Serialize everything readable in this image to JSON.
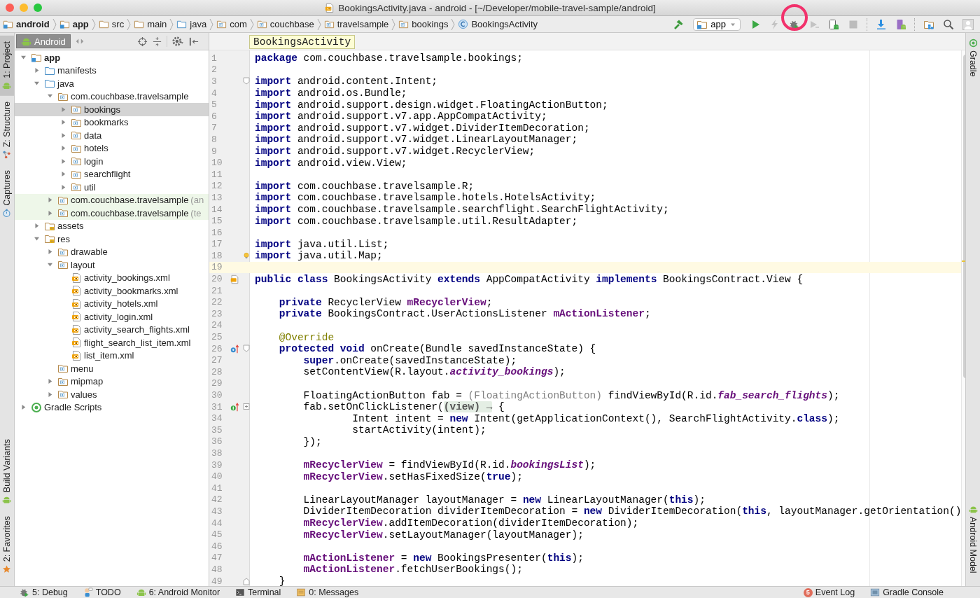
{
  "window": {
    "title": "BookingsActivity.java - android - [~/Developer/mobile-travel-sample/android]"
  },
  "breadcrumbs": [
    {
      "label": "android",
      "kind": "module",
      "bold": true
    },
    {
      "label": "app",
      "kind": "module",
      "bold": true
    },
    {
      "label": "src",
      "kind": "folder",
      "bold": false
    },
    {
      "label": "main",
      "kind": "folder",
      "bold": false
    },
    {
      "label": "java",
      "kind": "source",
      "bold": false
    },
    {
      "label": "com",
      "kind": "package",
      "bold": false
    },
    {
      "label": "couchbase",
      "kind": "package",
      "bold": false
    },
    {
      "label": "travelsample",
      "kind": "package",
      "bold": false
    },
    {
      "label": "bookings",
      "kind": "package",
      "bold": false
    },
    {
      "label": "BookingsActivity",
      "kind": "class",
      "bold": false
    }
  ],
  "toolbar": [
    {
      "kind": "hammer",
      "disabled": false,
      "highlighted": false
    },
    {
      "kind": "config",
      "label": "app",
      "disabled": false,
      "highlighted": false
    },
    {
      "kind": "run",
      "disabled": false,
      "highlighted": false
    },
    {
      "kind": "apply",
      "disabled": true,
      "highlighted": false
    },
    {
      "kind": "debug",
      "disabled": false,
      "highlighted": true
    },
    {
      "kind": "attach",
      "disabled": true,
      "highlighted": false
    },
    {
      "kind": "device",
      "disabled": false,
      "highlighted": false
    },
    {
      "kind": "stop",
      "disabled": true,
      "highlighted": false
    },
    {
      "kind": "sdk",
      "disabled": false,
      "highlighted": false
    },
    {
      "kind": "avd",
      "disabled": false,
      "highlighted": false
    },
    {
      "kind": "structure",
      "disabled": false,
      "highlighted": false
    },
    {
      "kind": "search",
      "disabled": false,
      "highlighted": false
    },
    {
      "kind": "avatar",
      "disabled": false,
      "highlighted": false
    }
  ],
  "left_stripe": {
    "top": [
      {
        "label": "1: Project",
        "kind": "android",
        "selected": true
      },
      {
        "label": "Z: Structure",
        "kind": "structure",
        "selected": false
      },
      {
        "label": "Captures",
        "kind": "captures",
        "selected": false
      }
    ],
    "bottom": [
      {
        "label": "Build Variants",
        "kind": "android",
        "selected": false
      },
      {
        "label": "2: Favorites",
        "kind": "star",
        "selected": false
      }
    ]
  },
  "right_stripe": {
    "top": [
      {
        "label": "Gradle",
        "kind": "gradle"
      }
    ],
    "bottom": [
      {
        "label": "Android Model",
        "kind": "android"
      }
    ]
  },
  "project": {
    "view": "Android",
    "tree": [
      {
        "label": "app",
        "kind": "module",
        "bold": true,
        "expanded": true,
        "selected": false,
        "children": [
          {
            "label": "manifests",
            "kind": "source",
            "expanded": false,
            "selected": false
          },
          {
            "label": "java",
            "kind": "source",
            "expanded": true,
            "selected": false,
            "children": [
              {
                "label": "com.couchbase.travelsample",
                "kind": "package",
                "expanded": true,
                "selected": false,
                "children": [
                  {
                    "label": "bookings",
                    "kind": "package",
                    "expanded": false,
                    "selected": true
                  },
                  {
                    "label": "bookmarks",
                    "kind": "package",
                    "expanded": false,
                    "selected": false
                  },
                  {
                    "label": "data",
                    "kind": "package",
                    "expanded": false,
                    "selected": false
                  },
                  {
                    "label": "hotels",
                    "kind": "package",
                    "expanded": false,
                    "selected": false
                  },
                  {
                    "label": "login",
                    "kind": "package",
                    "expanded": false,
                    "selected": false
                  },
                  {
                    "label": "searchflight",
                    "kind": "package",
                    "expanded": false,
                    "selected": false
                  },
                  {
                    "label": "util",
                    "kind": "package",
                    "expanded": false,
                    "selected": false
                  }
                ]
              },
              {
                "label": "com.couchbase.travelsample",
                "note": "(an",
                "kind": "test-package",
                "expanded": false,
                "selected": false
              },
              {
                "label": "com.couchbase.travelsample",
                "note": "(te",
                "kind": "test-package",
                "expanded": false,
                "selected": false
              }
            ]
          },
          {
            "label": "assets",
            "kind": "resources",
            "expanded": false,
            "selected": false
          },
          {
            "label": "res",
            "kind": "resources",
            "expanded": true,
            "selected": false,
            "children": [
              {
                "label": "drawable",
                "kind": "package",
                "expanded": false,
                "selected": false
              },
              {
                "label": "layout",
                "kind": "package",
                "expanded": true,
                "selected": false,
                "children": [
                  {
                    "label": "activity_bookings.xml",
                    "kind": "xml",
                    "selected": false
                  },
                  {
                    "label": "activity_bookmarks.xml",
                    "kind": "xml",
                    "selected": false
                  },
                  {
                    "label": "activity_hotels.xml",
                    "kind": "xml",
                    "selected": false
                  },
                  {
                    "label": "activity_login.xml",
                    "kind": "xml",
                    "selected": false
                  },
                  {
                    "label": "activity_search_flights.xml",
                    "kind": "xml",
                    "selected": false
                  },
                  {
                    "label": "flight_search_list_item.xml",
                    "kind": "xml",
                    "selected": false
                  },
                  {
                    "label": "list_item.xml",
                    "kind": "xml",
                    "selected": false
                  }
                ]
              },
              {
                "label": "menu",
                "kind": "package",
                "selected": false
              },
              {
                "label": "mipmap",
                "kind": "package",
                "expanded": false,
                "selected": false
              },
              {
                "label": "values",
                "kind": "package",
                "expanded": false,
                "selected": false
              }
            ]
          }
        ]
      },
      {
        "label": "Gradle Scripts",
        "kind": "gradle",
        "expanded": false,
        "selected": false
      }
    ]
  },
  "editor": {
    "tooltip": "BookingsActivity",
    "lines": [
      {
        "number": "1",
        "current": false,
        "code": [
          {
            "kind": "keyword",
            "text": "package"
          },
          {
            "kind": "plain",
            "text": " com.couchbase.travelsample.bookings;"
          }
        ]
      },
      {
        "number": "2",
        "current": false
      },
      {
        "number": "3",
        "current": false,
        "fold": {
          "kind": "start"
        },
        "code": [
          {
            "kind": "keyword",
            "text": "import"
          },
          {
            "kind": "plain",
            "text": " android.content.Intent;"
          }
        ]
      },
      {
        "number": "4",
        "current": false,
        "code": [
          {
            "kind": "keyword",
            "text": "import"
          },
          {
            "kind": "plain",
            "text": " android.os.Bundle;"
          }
        ]
      },
      {
        "number": "5",
        "current": false,
        "code": [
          {
            "kind": "keyword",
            "text": "import"
          },
          {
            "kind": "plain",
            "text": " android.support.design.widget.FloatingActionButton;"
          }
        ]
      },
      {
        "number": "6",
        "current": false,
        "code": [
          {
            "kind": "keyword",
            "text": "import"
          },
          {
            "kind": "plain",
            "text": " android.support.v7.app.AppCompatActivity;"
          }
        ]
      },
      {
        "number": "7",
        "current": false,
        "code": [
          {
            "kind": "keyword",
            "text": "import"
          },
          {
            "kind": "plain",
            "text": " android.support.v7.widget.DividerItemDecoration;"
          }
        ]
      },
      {
        "number": "8",
        "current": false,
        "code": [
          {
            "kind": "keyword",
            "text": "import"
          },
          {
            "kind": "plain",
            "text": " android.support.v7.widget.LinearLayoutManager;"
          }
        ]
      },
      {
        "number": "9",
        "current": false,
        "code": [
          {
            "kind": "keyword",
            "text": "import"
          },
          {
            "kind": "plain",
            "text": " android.support.v7.widget.RecyclerView;"
          }
        ]
      },
      {
        "number": "10",
        "current": false,
        "code": [
          {
            "kind": "keyword",
            "text": "import"
          },
          {
            "kind": "plain",
            "text": " android.view.View;"
          }
        ]
      },
      {
        "number": "11",
        "current": false
      },
      {
        "number": "12",
        "current": false,
        "code": [
          {
            "kind": "keyword",
            "text": "import"
          },
          {
            "kind": "plain",
            "text": " com.couchbase.travelsample.R;"
          }
        ]
      },
      {
        "number": "13",
        "current": false,
        "code": [
          {
            "kind": "keyword",
            "text": "import"
          },
          {
            "kind": "plain",
            "text": " com.couchbase.travelsample.hotels.HotelsActivity;"
          }
        ]
      },
      {
        "number": "14",
        "current": false,
        "code": [
          {
            "kind": "keyword",
            "text": "import"
          },
          {
            "kind": "plain",
            "text": " com.couchbase.travelsample.searchflight.SearchFlightActivity;"
          }
        ]
      },
      {
        "number": "15",
        "current": false,
        "code": [
          {
            "kind": "keyword",
            "text": "import"
          },
          {
            "kind": "plain",
            "text": " com.couchbase.travelsample.util.ResultAdapter;"
          }
        ]
      },
      {
        "number": "16",
        "current": false
      },
      {
        "number": "17",
        "current": false,
        "code": [
          {
            "kind": "keyword",
            "text": "import"
          },
          {
            "kind": "plain",
            "text": " java.util.List;"
          }
        ]
      },
      {
        "number": "18",
        "current": false,
        "marker": {
          "kind": "bulb"
        },
        "code": [
          {
            "kind": "keyword",
            "text": "import"
          },
          {
            "kind": "plain",
            "text": " java.util.Map;"
          }
        ]
      },
      {
        "number": "19",
        "current": true
      },
      {
        "number": "20",
        "current": false,
        "marker": {
          "kind": "layout"
        },
        "code": [
          {
            "kind": "keyword",
            "text": "public class"
          },
          {
            "kind": "plain",
            "text": " BookingsActivity "
          },
          {
            "kind": "keyword",
            "text": "extends"
          },
          {
            "kind": "plain",
            "text": " AppCompatActivity "
          },
          {
            "kind": "keyword",
            "text": "implements"
          },
          {
            "kind": "plain",
            "text": " BookingsContract.View {"
          }
        ]
      },
      {
        "number": "21",
        "current": false
      },
      {
        "number": "22",
        "current": false,
        "code": [
          {
            "kind": "keyword",
            "text": "    private"
          },
          {
            "kind": "plain",
            "text": " RecyclerView "
          },
          {
            "kind": "field",
            "text": "mRecyclerView"
          },
          {
            "kind": "plain",
            "text": ";"
          }
        ]
      },
      {
        "number": "23",
        "current": false,
        "code": [
          {
            "kind": "keyword",
            "text": "    private"
          },
          {
            "kind": "plain",
            "text": " BookingsContract.UserActionsListener "
          },
          {
            "kind": "field",
            "text": "mActionListener"
          },
          {
            "kind": "plain",
            "text": ";"
          }
        ]
      },
      {
        "number": "24",
        "current": false
      },
      {
        "number": "25",
        "current": false,
        "code": [
          {
            "kind": "annotation",
            "text": "    @Override"
          }
        ]
      },
      {
        "number": "26",
        "current": false,
        "marker": {
          "kind": "override"
        },
        "fold": {
          "kind": "start"
        },
        "code": [
          {
            "kind": "keyword",
            "text": "    protected void"
          },
          {
            "kind": "plain",
            "text": " onCreate(Bundle savedInstanceState) {"
          }
        ]
      },
      {
        "number": "27",
        "current": false,
        "code": [
          {
            "kind": "keyword",
            "text": "        super"
          },
          {
            "kind": "plain",
            "text": ".onCreate(savedInstanceState);"
          }
        ]
      },
      {
        "number": "28",
        "current": false,
        "code": [
          {
            "kind": "plain",
            "text": "        setContentView(R.layout."
          },
          {
            "kind": "static",
            "text": "activity_bookings"
          },
          {
            "kind": "plain",
            "text": ");"
          }
        ]
      },
      {
        "number": "29",
        "current": false
      },
      {
        "number": "30",
        "current": false,
        "code": [
          {
            "kind": "plain",
            "text": "        FloatingActionButton fab = "
          },
          {
            "kind": "unused",
            "text": "(FloatingActionButton)"
          },
          {
            "kind": "plain",
            "text": " findViewById(R.id."
          },
          {
            "kind": "static",
            "text": "fab_search_flights"
          },
          {
            "kind": "plain",
            "text": ");"
          }
        ]
      },
      {
        "number": "31",
        "current": false,
        "marker": {
          "kind": "implement"
        },
        "fold": {
          "kind": "collapsed"
        },
        "code": [
          {
            "kind": "plain",
            "text": "        fab.setOnClickListener("
          },
          {
            "kind": "folded",
            "text": "(view) →"
          },
          {
            "kind": "plain",
            "text": " {"
          }
        ]
      },
      {
        "number": "34",
        "current": false,
        "code": [
          {
            "kind": "plain",
            "text": "                Intent intent = "
          },
          {
            "kind": "keyword",
            "text": "new"
          },
          {
            "kind": "plain",
            "text": " Intent(getApplicationContext(), SearchFlightActivity."
          },
          {
            "kind": "keyword",
            "text": "class"
          },
          {
            "kind": "plain",
            "text": ");"
          }
        ]
      },
      {
        "number": "35",
        "current": false,
        "code": [
          {
            "kind": "plain",
            "text": "                startActivity(intent);"
          }
        ]
      },
      {
        "number": "36",
        "current": false,
        "code": [
          {
            "kind": "plain",
            "text": "        });"
          }
        ]
      },
      {
        "number": "38",
        "current": false
      },
      {
        "number": "39",
        "current": false,
        "code": [
          {
            "kind": "field",
            "text": "        mRecyclerView"
          },
          {
            "kind": "plain",
            "text": " = findViewById(R.id."
          },
          {
            "kind": "static",
            "text": "bookingsList"
          },
          {
            "kind": "plain",
            "text": ");"
          }
        ]
      },
      {
        "number": "40",
        "current": false,
        "code": [
          {
            "kind": "field",
            "text": "        mRecyclerView"
          },
          {
            "kind": "plain",
            "text": ".setHasFixedSize("
          },
          {
            "kind": "keyword",
            "text": "true"
          },
          {
            "kind": "plain",
            "text": ");"
          }
        ]
      },
      {
        "number": "41",
        "current": false
      },
      {
        "number": "42",
        "current": false,
        "code": [
          {
            "kind": "plain",
            "text": "        LinearLayoutManager layoutManager = "
          },
          {
            "kind": "keyword",
            "text": "new"
          },
          {
            "kind": "plain",
            "text": " LinearLayoutManager("
          },
          {
            "kind": "keyword",
            "text": "this"
          },
          {
            "kind": "plain",
            "text": ");"
          }
        ]
      },
      {
        "number": "43",
        "current": false,
        "code": [
          {
            "kind": "plain",
            "text": "        DividerItemDecoration dividerItemDecoration = "
          },
          {
            "kind": "keyword",
            "text": "new"
          },
          {
            "kind": "plain",
            "text": " DividerItemDecoration("
          },
          {
            "kind": "keyword",
            "text": "this"
          },
          {
            "kind": "plain",
            "text": ", layoutManager.getOrientation()"
          }
        ]
      },
      {
        "number": "44",
        "current": false,
        "code": [
          {
            "kind": "field",
            "text": "        mRecyclerView"
          },
          {
            "kind": "plain",
            "text": ".addItemDecoration(dividerItemDecoration);"
          }
        ]
      },
      {
        "number": "45",
        "current": false,
        "code": [
          {
            "kind": "field",
            "text": "        mRecyclerView"
          },
          {
            "kind": "plain",
            "text": ".setLayoutManager(layoutManager);"
          }
        ]
      },
      {
        "number": "46",
        "current": false
      },
      {
        "number": "47",
        "current": false,
        "code": [
          {
            "kind": "field",
            "text": "        mActionListener"
          },
          {
            "kind": "plain",
            "text": " = "
          },
          {
            "kind": "keyword",
            "text": "new"
          },
          {
            "kind": "plain",
            "text": " BookingsPresenter("
          },
          {
            "kind": "keyword",
            "text": "this"
          },
          {
            "kind": "plain",
            "text": ");"
          }
        ]
      },
      {
        "number": "48",
        "current": false,
        "code": [
          {
            "kind": "field",
            "text": "        mActionListener"
          },
          {
            "kind": "plain",
            "text": ".fetchUserBookings();"
          }
        ]
      },
      {
        "number": "49",
        "current": false,
        "fold": {
          "kind": "end"
        },
        "code": [
          {
            "kind": "plain",
            "text": "    }"
          }
        ]
      }
    ]
  },
  "status_bar": {
    "left": [
      {
        "label": "5: Debug",
        "kind": "debug"
      },
      {
        "label": "TODO",
        "kind": "todo"
      },
      {
        "label": "6: Android Monitor",
        "kind": "android"
      },
      {
        "label": "Terminal",
        "kind": "terminal"
      },
      {
        "label": "0: Messages",
        "kind": "messages"
      }
    ],
    "right": [
      {
        "label": "Event Log",
        "kind": "event",
        "badge": "5"
      },
      {
        "label": "Gradle Console",
        "kind": "console"
      }
    ]
  }
}
